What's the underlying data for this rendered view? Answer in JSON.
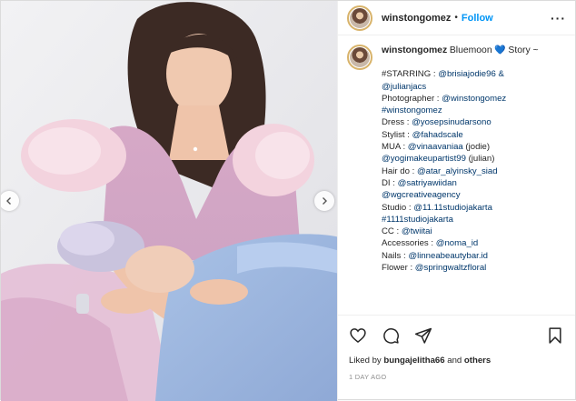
{
  "header": {
    "username": "winstongomez",
    "separator": "•",
    "follow_label": "Follow",
    "more_label": "···"
  },
  "caption": {
    "username": "winstongomez",
    "title_text": "Bluemoon",
    "title_emoji": "💙",
    "title_suffix": "Story ~",
    "lines": [
      {
        "prefix": "#STARRING : ",
        "tag": "@brisiajodie96 &",
        "rest": ""
      },
      {
        "prefix": "",
        "tag": "@julianjacs",
        "rest": ""
      },
      {
        "prefix": "Photographer : ",
        "tag": "@winstongomez",
        "rest": ""
      },
      {
        "prefix": "",
        "tag": "#winstongomez",
        "rest": ""
      },
      {
        "prefix": "Dress : ",
        "tag": "@yosepsinudarsono",
        "rest": ""
      },
      {
        "prefix": "Stylist : ",
        "tag": "@fahadscale",
        "rest": ""
      },
      {
        "prefix": "MUA : ",
        "tag": "@vinaavaniaa",
        "rest": " (jodie)"
      },
      {
        "prefix": "",
        "tag": "@yogimakeupartist99",
        "rest": " (julian)"
      },
      {
        "prefix": "Hair do : ",
        "tag": "@atar_alyinsky_siad",
        "rest": ""
      },
      {
        "prefix": "DI : ",
        "tag": "@satriyawiidan",
        "rest": ""
      },
      {
        "prefix": "",
        "tag": "@wgcreativeagency",
        "rest": ""
      },
      {
        "prefix": "Studio : ",
        "tag": "@11.11studiojakarta",
        "rest": ""
      },
      {
        "prefix": "",
        "tag": "#1111studiojakarta",
        "rest": ""
      },
      {
        "prefix": "CC : ",
        "tag": "@twiitai",
        "rest": ""
      },
      {
        "prefix": "Accessories : ",
        "tag": "@noma_id",
        "rest": ""
      },
      {
        "prefix": "Nails : ",
        "tag": "@linneabeautybar.id",
        "rest": ""
      },
      {
        "prefix": "Flower : ",
        "tag": "@springwaltzfloral",
        "rest": ""
      }
    ]
  },
  "actions": {
    "icons": [
      "heart-icon",
      "comment-icon",
      "share-icon",
      "bookmark-icon"
    ]
  },
  "likes": {
    "prefix": "Liked by ",
    "user": "bungajelitha66",
    "middle": " and ",
    "others": "others"
  },
  "timestamp": "1 DAY AGO",
  "colors": {
    "accent": "#0095f6",
    "link": "#00376b",
    "text": "#262626",
    "muted": "#8e8e8e",
    "heart_emoji": "#1f5fbf"
  }
}
